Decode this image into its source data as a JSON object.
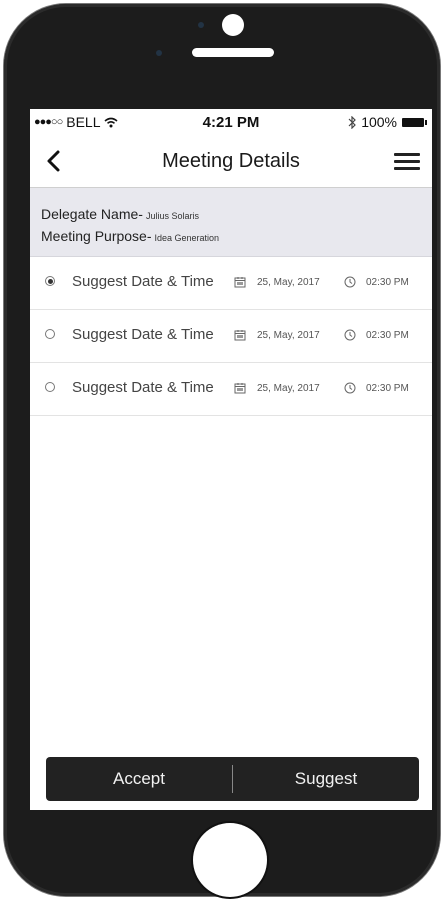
{
  "status": {
    "carrier": "BELL",
    "time": "4:21 PM",
    "battery": "100%"
  },
  "nav": {
    "title": "Meeting Details"
  },
  "details": {
    "delegate_label": "Delegate Name-",
    "delegate_value": "Julius Solaris",
    "purpose_label": "Meeting Purpose-",
    "purpose_value": "Idea Generation"
  },
  "options": [
    {
      "label": "Suggest Date & Time",
      "date": "25, May, 2017",
      "time": "02:30 PM",
      "selected": true
    },
    {
      "label": "Suggest Date & Time",
      "date": "25, May, 2017",
      "time": "02:30 PM",
      "selected": false
    },
    {
      "label": "Suggest Date & Time",
      "date": "25, May, 2017",
      "time": "02:30 PM",
      "selected": false
    }
  ],
  "actions": {
    "accept": "Accept",
    "suggest": "Suggest"
  },
  "icons": [
    "wifi-icon",
    "bluetooth-icon",
    "battery-icon",
    "back-chevron-icon",
    "menu-icon",
    "calendar-icon",
    "clock-icon"
  ]
}
